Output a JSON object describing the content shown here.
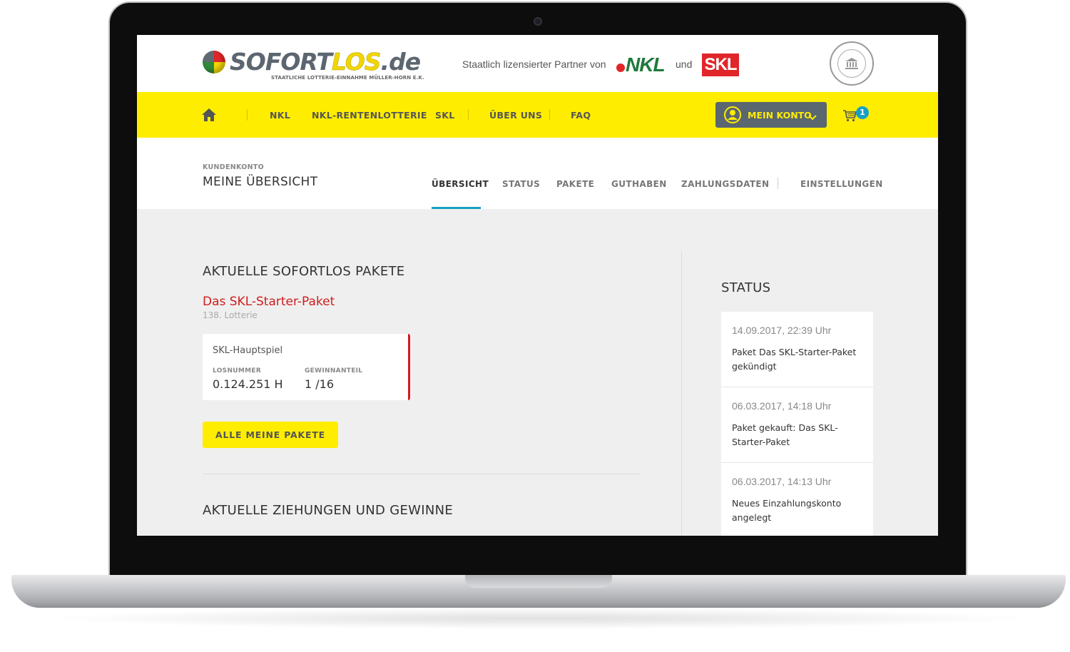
{
  "header": {
    "logo_main": "SOFORT",
    "logo_highlight": "LOS",
    "logo_tld": ".de",
    "logo_tagline": "STAATLICHE LOTTERIE-EINNAHME MÜLLER-HORN E.K.",
    "partner_text": "Staatlich lizensierter Partner von",
    "nkl_logo": "NKL",
    "and_text": "und",
    "skl_logo": "SKL",
    "seal_icon": "bank-building-icon"
  },
  "nav": {
    "items": [
      "NKL",
      "NKL-RENTENLOTTERIE",
      "SKL",
      "ÜBER UNS",
      "FAQ"
    ],
    "account_label": "MEIN KONTO",
    "cart_count": "1"
  },
  "account": {
    "breadcrumb": "KUNDENKONTO",
    "title": "MEINE ÜBERSICHT",
    "tabs": [
      "ÜBERSICHT",
      "STATUS",
      "PAKETE",
      "GUTHABEN",
      "ZAHLUNGSDATEN",
      "EINSTELLUNGEN"
    ],
    "active_tab": "ÜBERSICHT"
  },
  "packages": {
    "heading": "AKTUELLE SOFORTLOS PAKETE",
    "package_name": "Das SKL-Starter-Paket",
    "package_sub": "138. Lotterie",
    "ticket": {
      "title": "SKL-Hauptspiel",
      "losnummer_label": "LOSNUMMER",
      "losnummer_value": "0.124.251 H",
      "gewinnanteil_label": "GEWINNANTEIL",
      "gewinnanteil_value": "1 /16"
    },
    "all_button": "ALLE MEINE PAKETE"
  },
  "draws": {
    "heading": "AKTUELLE ZIEHUNGEN UND GEWINNE"
  },
  "status": {
    "heading": "STATUS",
    "items": [
      {
        "time": "14.09.2017, 22:39 Uhr",
        "text": "Paket Das SKL-Starter-Paket gekündigt"
      },
      {
        "time": "06.03.2017, 14:18 Uhr",
        "text": "Paket gekauft: Das SKL-Starter-Paket"
      },
      {
        "time": "06.03.2017, 14:13 Uhr",
        "text": "Neues Einzahlungskonto angelegt"
      }
    ]
  },
  "colors": {
    "brand_yellow": "#ffed00",
    "accent_red": "#d01c1c",
    "accent_blue": "#17a0c6",
    "button_gray": "#5a6670"
  }
}
